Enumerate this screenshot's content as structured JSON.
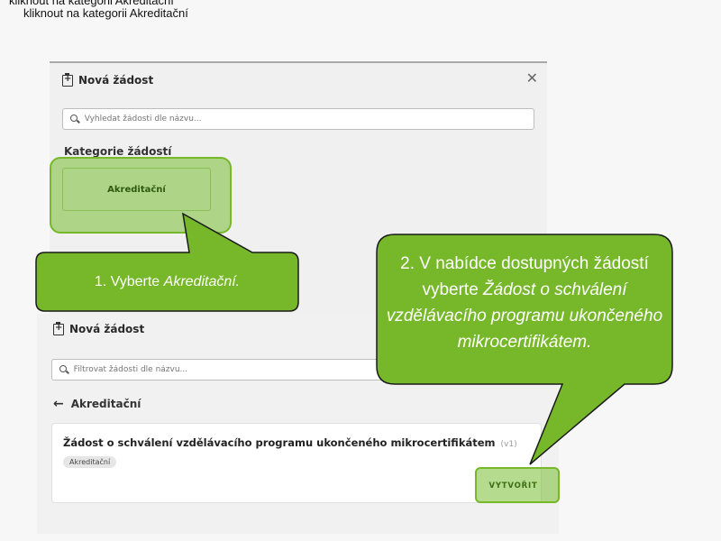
{
  "caption": {
    "line1": "kliknout na kategorii Akreditační",
    "line2": "kliknout na kategorii Akreditační"
  },
  "dialog1": {
    "title": "Nová žádost",
    "close_icon": "close-icon",
    "search_placeholder": "Vyhledat žádosti dle názvu...",
    "category_heading": "Kategorie žádostí",
    "category_button": "Akreditační"
  },
  "dialog2": {
    "title": "Nová žádost",
    "search_placeholder": "Filtrovat žádosti dle názvu...",
    "back_label": "Akreditační",
    "request": {
      "title": "Žádost o schválení vzdělávacího programu ukončeného mikrocertifikátem",
      "version": "(v1)",
      "tag": "Akreditační",
      "create_label": "VYTVOŘIT"
    }
  },
  "callout1": {
    "prefix": "1. Vyberte ",
    "emphasis": "Akreditační."
  },
  "callout2": {
    "prefix": "2. V nabídce dostupných žádostí vyberte ",
    "emphasis": "Žádost o schválení vzdělávacího programu ukončeného mikrocertifikátem."
  },
  "colors": {
    "callout_fill": "#76b82a",
    "callout_border": "#1a1a1a",
    "highlight": "#76b82a"
  }
}
